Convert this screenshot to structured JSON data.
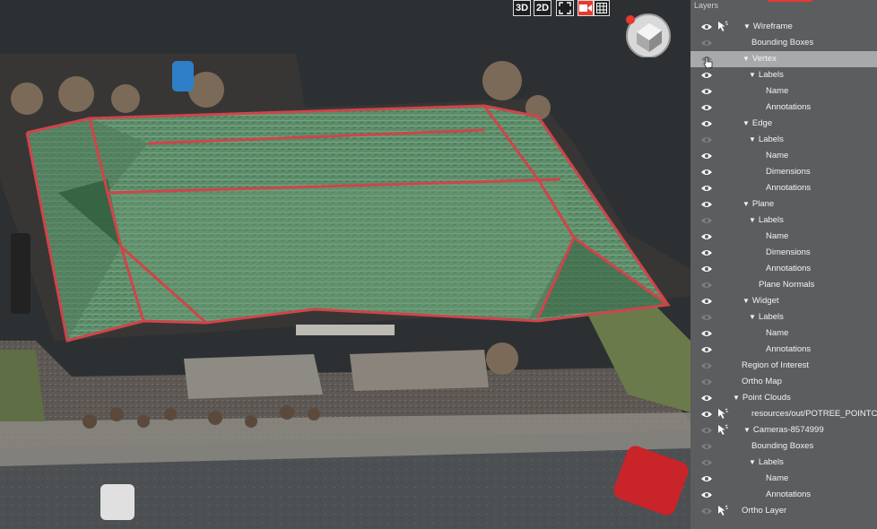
{
  "viewport": {
    "toolbar": {
      "btn_3d": "3D",
      "btn_2d": "2D"
    }
  },
  "panel": {
    "title": "Layers",
    "items": [
      {
        "label": "Wireframe",
        "eye": "visible",
        "pointer": true,
        "caret": "▼"
      },
      {
        "label": "Bounding Boxes",
        "eye": "hidden",
        "pointer": false,
        "caret": ""
      },
      {
        "label": "Vertex",
        "eye": "hidden",
        "pointer": false,
        "caret": "▼",
        "selected": true
      },
      {
        "label": "Labels",
        "eye": "visible",
        "pointer": false,
        "caret": "▼"
      },
      {
        "label": "Name",
        "eye": "visible",
        "pointer": false,
        "caret": ""
      },
      {
        "label": "Annotations",
        "eye": "visible",
        "pointer": false,
        "caret": ""
      },
      {
        "label": "Edge",
        "eye": "visible",
        "pointer": false,
        "caret": "▼"
      },
      {
        "label": "Labels",
        "eye": "hidden",
        "pointer": false,
        "caret": "▼"
      },
      {
        "label": "Name",
        "eye": "visible",
        "pointer": false,
        "caret": ""
      },
      {
        "label": "Dimensions",
        "eye": "visible",
        "pointer": false,
        "caret": ""
      },
      {
        "label": "Annotations",
        "eye": "visible",
        "pointer": false,
        "caret": ""
      },
      {
        "label": "Plane",
        "eye": "visible",
        "pointer": false,
        "caret": "▼"
      },
      {
        "label": "Labels",
        "eye": "hidden",
        "pointer": false,
        "caret": "▼"
      },
      {
        "label": "Name",
        "eye": "visible",
        "pointer": false,
        "caret": ""
      },
      {
        "label": "Dimensions",
        "eye": "visible",
        "pointer": false,
        "caret": ""
      },
      {
        "label": "Annotations",
        "eye": "visible",
        "pointer": false,
        "caret": ""
      },
      {
        "label": "Plane Normals",
        "eye": "hidden",
        "pointer": false,
        "caret": ""
      },
      {
        "label": "Widget",
        "eye": "visible",
        "pointer": false,
        "caret": "▼"
      },
      {
        "label": "Labels",
        "eye": "hidden",
        "pointer": false,
        "caret": "▼"
      },
      {
        "label": "Name",
        "eye": "visible",
        "pointer": false,
        "caret": ""
      },
      {
        "label": "Annotations",
        "eye": "visible",
        "pointer": false,
        "caret": ""
      },
      {
        "label": "Region of Interest",
        "eye": "hidden",
        "pointer": false,
        "caret": ""
      },
      {
        "label": "Ortho Map",
        "eye": "hidden",
        "pointer": false,
        "caret": ""
      },
      {
        "label": "Point Clouds",
        "eye": "visible",
        "pointer": false,
        "caret": "▼"
      },
      {
        "label": "resources/out/POTREE_POINTC",
        "eye": "visible",
        "pointer": true,
        "caret": ""
      },
      {
        "label": "Cameras-8574999",
        "eye": "hidden",
        "pointer": true,
        "caret": "▼"
      },
      {
        "label": "Bounding Boxes",
        "eye": "hidden",
        "pointer": false,
        "caret": ""
      },
      {
        "label": "Labels",
        "eye": "hidden",
        "pointer": false,
        "caret": "▼"
      },
      {
        "label": "Name",
        "eye": "visible",
        "pointer": false,
        "caret": ""
      },
      {
        "label": "Annotations",
        "eye": "visible",
        "pointer": false,
        "caret": ""
      },
      {
        "label": "Ortho Layer",
        "eye": "hidden",
        "pointer": true,
        "caret": ""
      }
    ]
  },
  "colors": {
    "accent": "#e8392f",
    "panel_bg": "#5b5d5f",
    "selected_row": "#a7a9ab",
    "roof": "#5a8a67"
  }
}
